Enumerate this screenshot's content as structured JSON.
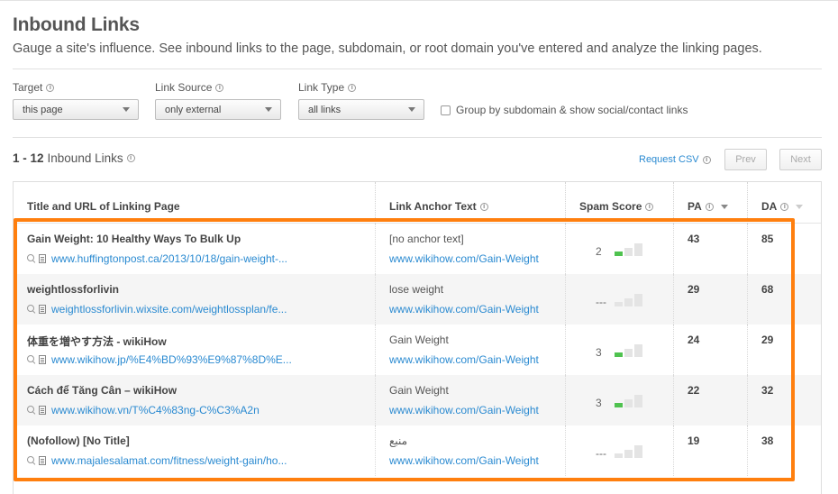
{
  "page": {
    "title": "Inbound Links",
    "subtitle": "Gauge a site's influence. See inbound links to the page, subdomain, or root domain you've entered and analyze the linking pages."
  },
  "filters": {
    "target": {
      "label": "Target",
      "value": "this page"
    },
    "link_source": {
      "label": "Link Source",
      "value": "only external"
    },
    "link_type": {
      "label": "Link Type",
      "value": "all links"
    },
    "group_toggle": {
      "label": "Group by subdomain & show social/contact links",
      "checked": false
    }
  },
  "results": {
    "range": "1 - 12",
    "label": "Inbound Links",
    "request_csv": "Request CSV",
    "prev": "Prev",
    "next": "Next"
  },
  "table": {
    "headers": {
      "title_url": "Title and URL of Linking Page",
      "anchor": "Link Anchor Text",
      "spam": "Spam Score",
      "pa": "PA",
      "da": "DA"
    },
    "rows": [
      {
        "title": "Gain Weight: 10 Healthy Ways To Bulk Up",
        "url": "www.huffingtonpost.ca/2013/10/18/gain-weight-...",
        "anchor": "[no anchor text]",
        "target": "www.wikihow.com/Gain-Weight",
        "spam": "2",
        "spam_level": 1,
        "pa": "43",
        "da": "85"
      },
      {
        "title": "weightlossforlivin",
        "url": "weightlossforlivin.wixsite.com/weightlossplan/fe...",
        "anchor": "lose weight",
        "target": "www.wikihow.com/Gain-Weight",
        "spam": "---",
        "spam_level": 0,
        "pa": "29",
        "da": "68"
      },
      {
        "title": "体重を増やす方法 - wikiHow",
        "url": "www.wikihow.jp/%E4%BD%93%E9%87%8D%E...",
        "anchor": "Gain Weight",
        "target": "www.wikihow.com/Gain-Weight",
        "spam": "3",
        "spam_level": 1,
        "pa": "24",
        "da": "29"
      },
      {
        "title": "Cách để Tăng Cân – wikiHow",
        "url": "www.wikihow.vn/T%C4%83ng-C%C3%A2n",
        "anchor": "Gain Weight",
        "target": "www.wikihow.com/Gain-Weight",
        "spam": "3",
        "spam_level": 1,
        "pa": "22",
        "da": "32"
      },
      {
        "title": "(Nofollow) [No Title]",
        "url": "www.majalesalamat.com/fitness/weight-gain/ho...",
        "anchor": "منبع",
        "target": "www.wikihow.com/Gain-Weight",
        "spam": "---",
        "spam_level": 0,
        "pa": "19",
        "da": "38"
      }
    ]
  },
  "colors": {
    "link": "#2a8ad1",
    "highlight": "#ff7f0e",
    "spam_bar_on": "#4fc24f"
  }
}
